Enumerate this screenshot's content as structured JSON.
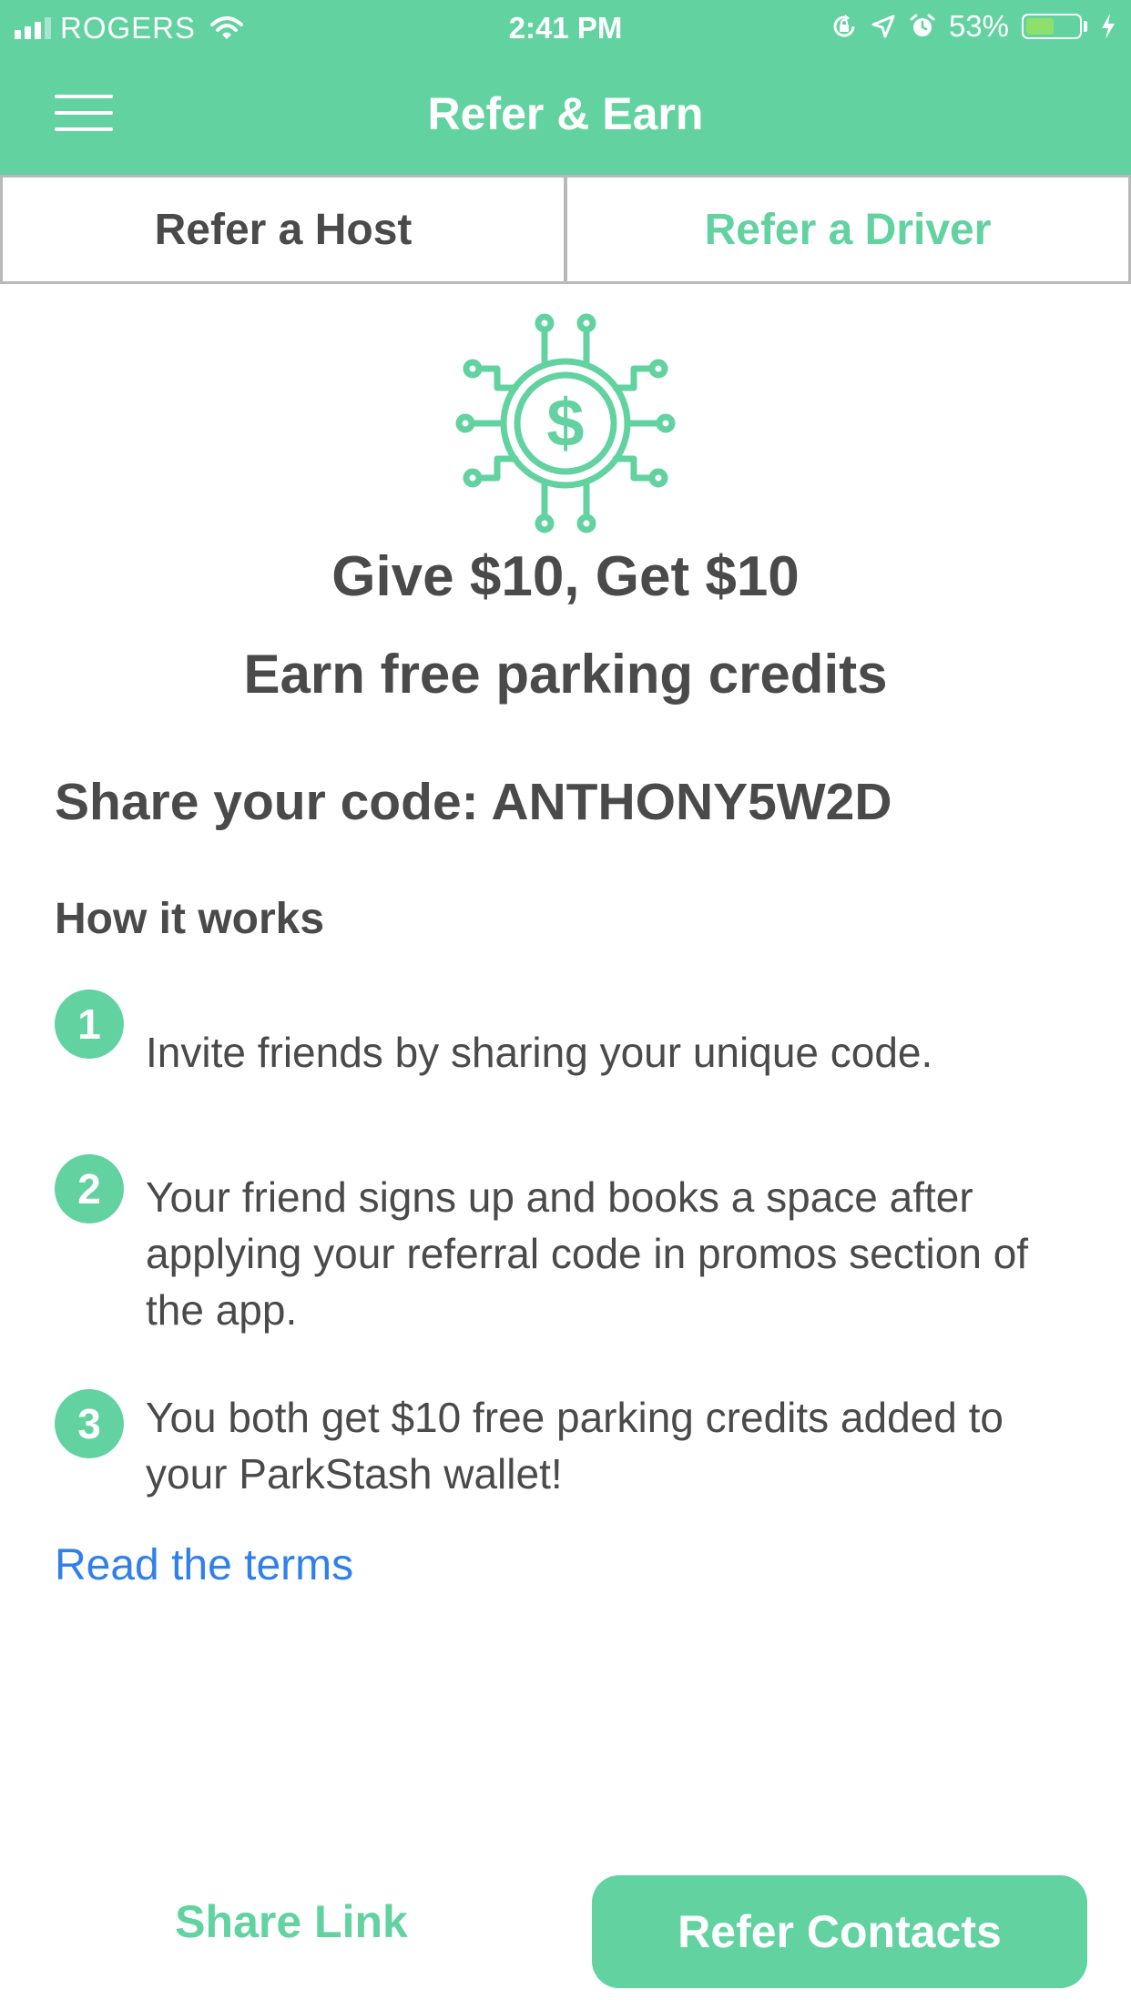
{
  "status_bar": {
    "carrier": "ROGERS",
    "time": "2:41 PM",
    "battery_percent": "53%",
    "battery_level": 0.53,
    "icons": [
      "signal-icon",
      "wifi-icon",
      "orientation-lock-icon",
      "location-icon",
      "alarm-icon",
      "battery-icon",
      "charging-icon"
    ]
  },
  "nav": {
    "title": "Refer & Earn",
    "menu_icon": "hamburger-menu-icon"
  },
  "tabs": [
    {
      "label": "Refer a Host",
      "selected": false
    },
    {
      "label": "Refer a Driver",
      "selected": true
    }
  ],
  "hero": {
    "icon": "dollar-circuit-icon",
    "headline": "Give $10, Get $10",
    "subheadline": "Earn free parking credits"
  },
  "share_code": {
    "text": "Share your code: ANTHONY5W2D"
  },
  "how_it_works": {
    "title": "How it works",
    "steps": [
      {
        "number": "1",
        "text": "Invite friends by sharing your unique code."
      },
      {
        "number": "2",
        "text": "Your friend signs up and books a space after applying your referral code in promos section of the app."
      },
      {
        "number": "3",
        "text": "You both get $10 free parking credits added to your ParkStash wallet!"
      }
    ]
  },
  "terms_link": "Read the terms",
  "actions": {
    "share_link": "Share Link",
    "refer_contacts": "Refer Contacts"
  },
  "colors": {
    "accent": "#61d2a0",
    "text": "#4a4a4a",
    "link": "#2f80ed",
    "battery_fill": "#8ee06c"
  }
}
